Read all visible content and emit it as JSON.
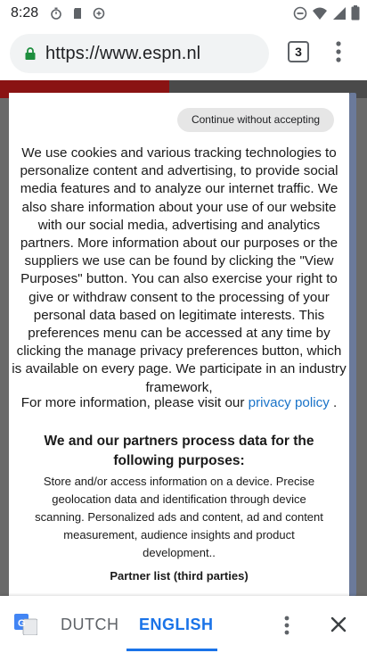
{
  "status_bar": {
    "time": "8:28"
  },
  "browser": {
    "url": "https://www.espn.nl",
    "tab_count": "3"
  },
  "consent": {
    "continue_label": "Continue without accepting",
    "body_lines": [
      "We use cookies and various tracking technologies to",
      "personalize content and advertising, to provide social",
      "media features and to analyze our internet traffic. We",
      "also share information about your use of our website",
      "with our social media, advertising and analytics",
      "partners. More information about our purposes or the",
      "suppliers we use can be found by clicking the \"View",
      "Purposes\" button. You can also exercise your right to",
      "give or withdraw consent to the processing of your",
      "personal data based on legitimate interests. This",
      "preferences menu can be accessed at any time by",
      "clicking the manage privacy preferences button, which",
      "is available on every page. We participate in an industry",
      "framework,"
    ],
    "more_info_prefix": "For more information, please visit our",
    "privacy_link": "privacy policy",
    "more_info_suffix": " .",
    "purposes_heading": "We and our partners process data for the following purposes:",
    "purposes_desc": "Store and/or access information on a device. Precise geolocation data and identification through device scanning. Personalized ads and content, ad and content measurement, audience insights and product development..",
    "partner_list": "Partner list (third parties)"
  },
  "translate": {
    "source_lang": "DUTCH",
    "target_lang": "ENGLISH"
  },
  "colors": {
    "accent": "#1a73e8",
    "link": "#1a73c8"
  }
}
